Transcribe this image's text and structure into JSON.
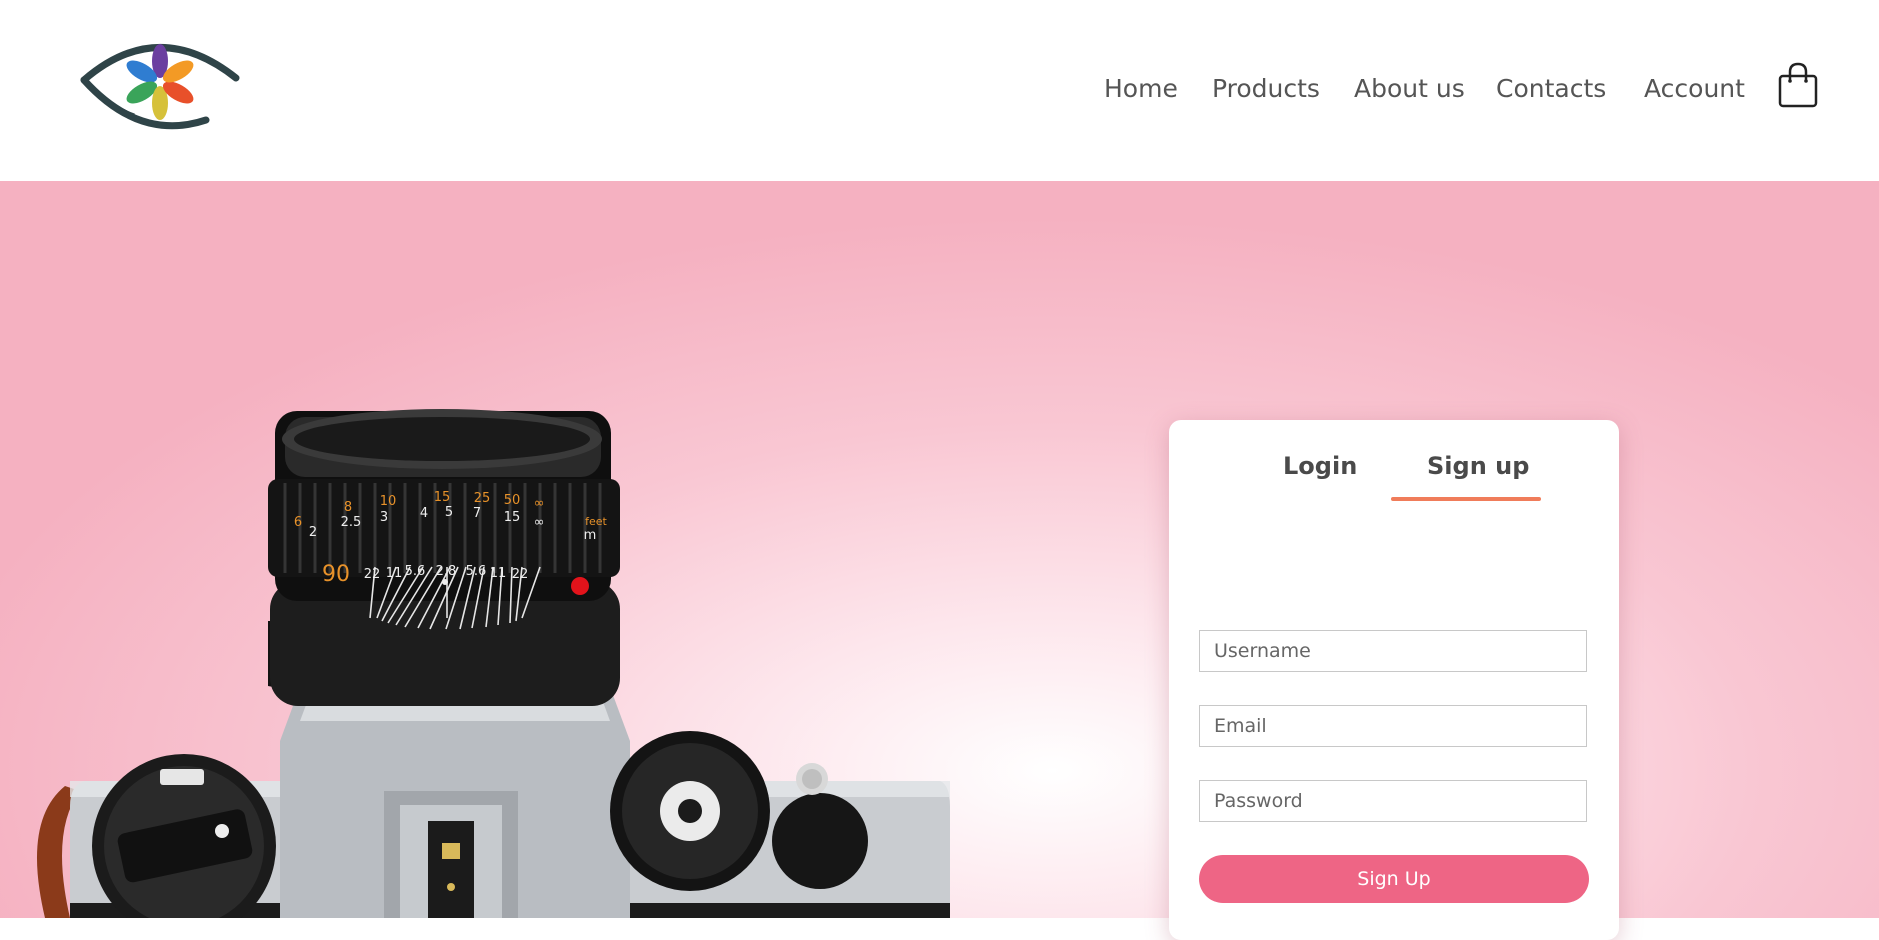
{
  "nav": {
    "items": [
      "Home",
      "Products",
      "About us",
      "Contacts",
      "Account"
    ]
  },
  "icons": {
    "logo": "eye-flower-logo",
    "cart": "shopping-bag-icon"
  },
  "camera_lens": {
    "scale_orange": [
      "6",
      "8",
      "10",
      "15",
      "25",
      "50",
      "∞",
      "feet"
    ],
    "scale_white": [
      "2",
      "2.5",
      "3",
      "4",
      "5",
      "7",
      "15",
      "∞",
      "m"
    ],
    "aperture": [
      "22",
      "11",
      "5.6",
      "2.8",
      "5.6",
      "11",
      "22"
    ],
    "focal": "90"
  },
  "auth": {
    "tabs": {
      "login": "Login",
      "signup": "Sign up"
    },
    "active_tab": "signup",
    "fields": {
      "username_placeholder": "Username",
      "email_placeholder": "Email",
      "password_placeholder": "Password"
    },
    "submit_label": "Sign Up"
  },
  "colors": {
    "accent": "#ee6585",
    "tab_underline": "#f07c5a",
    "hero_pink": "#f5b1c1",
    "text": "#555555"
  }
}
